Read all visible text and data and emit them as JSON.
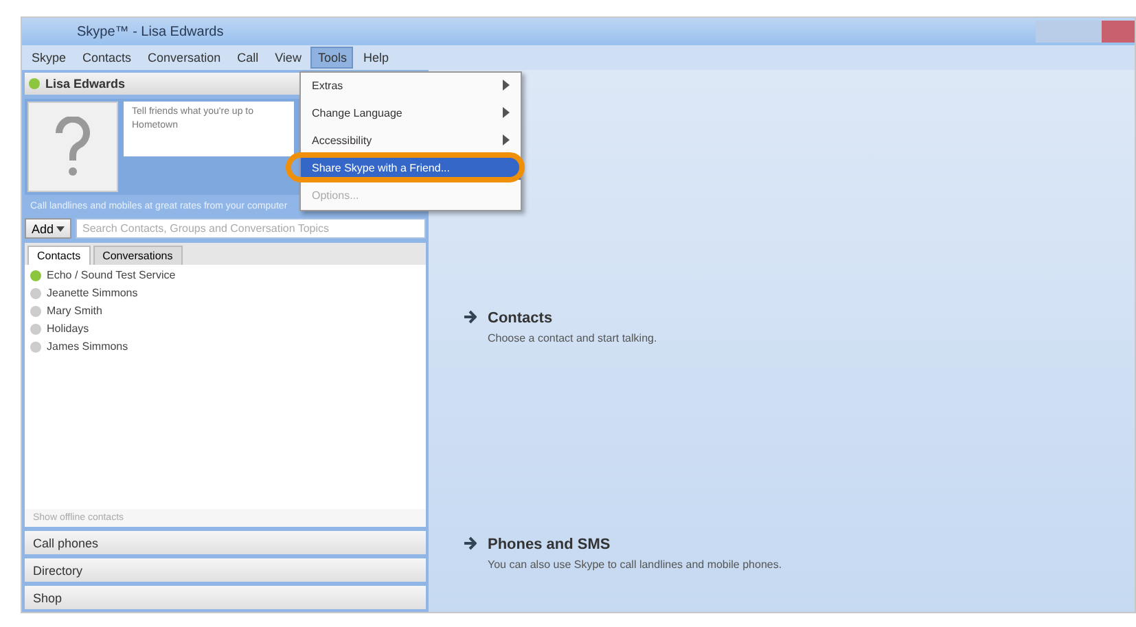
{
  "window": {
    "title": "Skype™ - Lisa Edwards"
  },
  "menu_bar": [
    {
      "label": "Skype",
      "selected": false
    },
    {
      "label": "Contacts",
      "selected": false
    },
    {
      "label": "Conversation",
      "selected": false
    },
    {
      "label": "Call",
      "selected": false
    },
    {
      "label": "View",
      "selected": false
    },
    {
      "label": "Tools",
      "selected": true
    },
    {
      "label": "Help",
      "selected": false
    }
  ],
  "dropdown": [
    {
      "label": "Extras",
      "submenu": true,
      "selected": false,
      "disabled": false
    },
    {
      "label": "Change Language",
      "submenu": true,
      "selected": false,
      "disabled": false
    },
    {
      "label": "Accessibility",
      "submenu": true,
      "selected": false,
      "disabled": false
    },
    {
      "label": "Share Skype with a Friend...",
      "submenu": false,
      "selected": true,
      "disabled": false
    },
    {
      "label": "Options...",
      "submenu": false,
      "selected": false,
      "disabled": true
    }
  ],
  "profile": {
    "name": "Lisa Edwards",
    "mood": "Tell friends what you're up to",
    "location": "Hometown",
    "notice": "Call landlines and mobiles at great rates from your computer"
  },
  "add_button": "Add",
  "search": {
    "placeholder": "Search Contacts, Groups and Conversation Topics"
  },
  "tabs": [
    {
      "label": "Contacts",
      "selected": true
    },
    {
      "label": "Conversations",
      "selected": false
    }
  ],
  "contacts": [
    {
      "name": "Echo / Sound Test Service",
      "online": true
    },
    {
      "name": "Jeanette Simmons",
      "online": false
    },
    {
      "name": "Mary Smith",
      "online": false
    },
    {
      "name": "Holidays",
      "online": false
    },
    {
      "name": "James Simmons",
      "online": false
    }
  ],
  "list_footer": "Show offline contacts",
  "bottom_items": [
    "Call phones",
    "Directory",
    "Shop"
  ],
  "home": [
    {
      "title": "Contacts",
      "text": "Choose a contact and start talking."
    },
    {
      "title": "Phones and SMS",
      "text": "You can also use Skype to call landlines and mobile phones."
    }
  ]
}
